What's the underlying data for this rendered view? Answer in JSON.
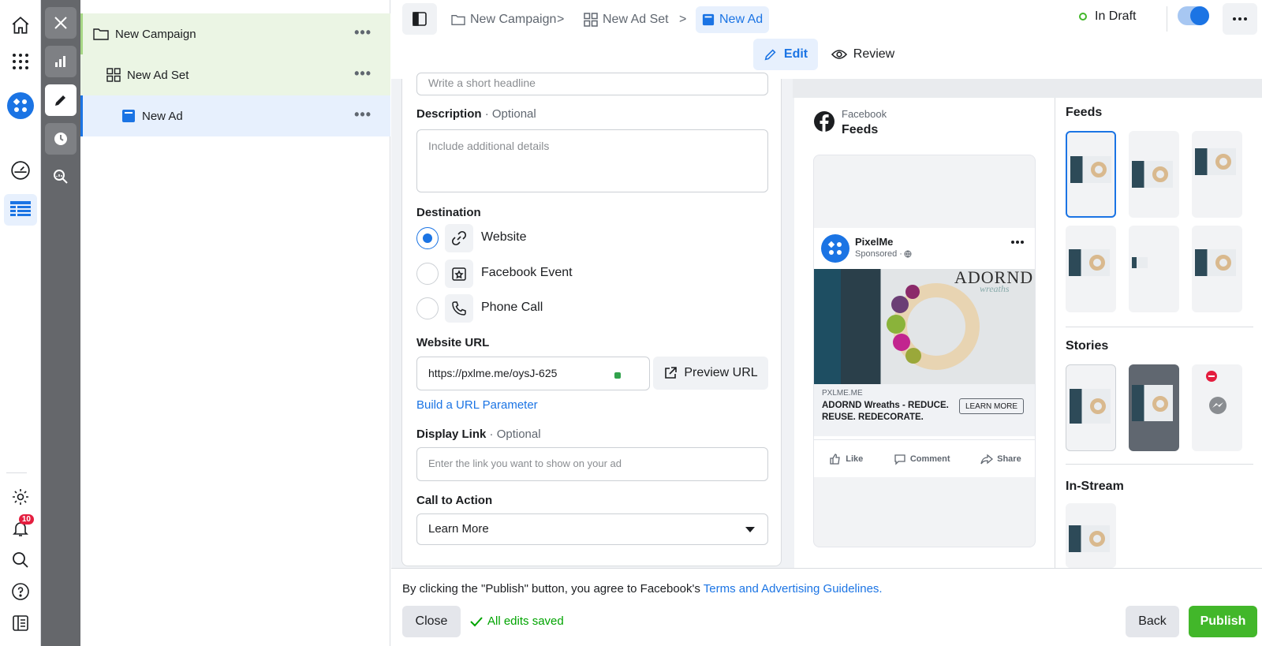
{
  "colors": {
    "accent": "#1b74e4",
    "publish": "#42b72a",
    "success": "#00a400",
    "badge": "#e41e3f"
  },
  "global_nav": {
    "icons": [
      "home-icon",
      "apps-grid-icon",
      "account-avatar-icon",
      "gauge-icon",
      "table-icon",
      "gear-icon",
      "bell-icon",
      "search-icon",
      "help-icon",
      "sidebar-toggle-icon"
    ],
    "notification_count": "10"
  },
  "tree": {
    "campaign": "New Campaign",
    "adset": "New Ad Set",
    "ad": "New Ad",
    "more": "•••"
  },
  "breadcrumb": {
    "campaign": "New Campaign",
    "adset": "New Ad Set",
    "ad": "New Ad",
    "separator": ">"
  },
  "status": {
    "label": "In Draft"
  },
  "modes": {
    "edit": "Edit",
    "review": "Review"
  },
  "form": {
    "headline_placeholder": "Write a short headline",
    "description_label": "Description",
    "description_optional": "· Optional",
    "description_placeholder": "Include additional details",
    "destination_label": "Destination",
    "destinations": [
      {
        "label": "Website",
        "checked": true
      },
      {
        "label": "Facebook Event",
        "checked": false
      },
      {
        "label": "Phone Call",
        "checked": false
      }
    ],
    "website_url_label": "Website URL",
    "website_url_value": "https://pxlme.me/oysJ-625",
    "preview_url_label": "Preview URL",
    "build_url_param": "Build a URL Parameter",
    "display_link_label": "Display Link",
    "display_link_optional": "· Optional",
    "display_link_placeholder": "Enter the link you want to show on your ad",
    "cta_label": "Call to Action",
    "cta_value": "Learn More"
  },
  "preview": {
    "platform": "Facebook",
    "placement": "Feeds",
    "page_name": "PixelMe",
    "sponsored": "Sponsored · ",
    "domain": "PXLME.ME",
    "ad_title": "ADORND Wreaths - REDUCE. REUSE. REDECORATE.",
    "cta_button": "LEARN MORE",
    "brand_text": "ADORND",
    "brand_script": "wreaths",
    "actions": [
      "Like",
      "Comment",
      "Share"
    ],
    "sections": {
      "feeds": "Feeds",
      "stories": "Stories",
      "instream": "In-Stream"
    }
  },
  "bottom": {
    "terms_prefix": "By clicking the \"Publish\" button, you agree to Facebook's ",
    "terms_link": "Terms and Advertising Guidelines.",
    "close": "Close",
    "saved": "All edits saved",
    "back": "Back",
    "publish": "Publish"
  }
}
